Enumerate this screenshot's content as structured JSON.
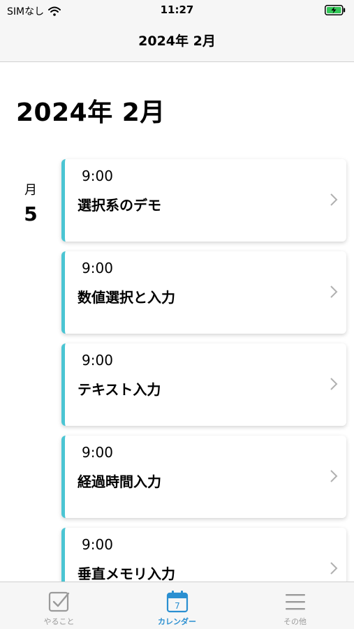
{
  "status_bar": {
    "carrier": "SIMなし",
    "time": "11:27"
  },
  "nav": {
    "title": "2024年 2月"
  },
  "page": {
    "title": "2024年 2月"
  },
  "day": {
    "weekday": "月",
    "date": "5"
  },
  "events": [
    {
      "time": "9:00",
      "title": "選択系のデモ"
    },
    {
      "time": "9:00",
      "title": "数値選択と入力"
    },
    {
      "time": "9:00",
      "title": "テキスト入力"
    },
    {
      "time": "9:00",
      "title": "経過時間入力"
    },
    {
      "time": "9:00",
      "title": "垂直メモリ入力"
    }
  ],
  "tabs": [
    {
      "label": "やること",
      "icon": "checkbox-icon"
    },
    {
      "label": "カレンダー",
      "icon": "calendar-icon",
      "badge": "7"
    },
    {
      "label": "その他",
      "icon": "menu-icon"
    }
  ],
  "colors": {
    "accent": "#4bc5d3",
    "tab_active": "#2a8fd1",
    "tab_inactive": "#9a9a9a"
  }
}
